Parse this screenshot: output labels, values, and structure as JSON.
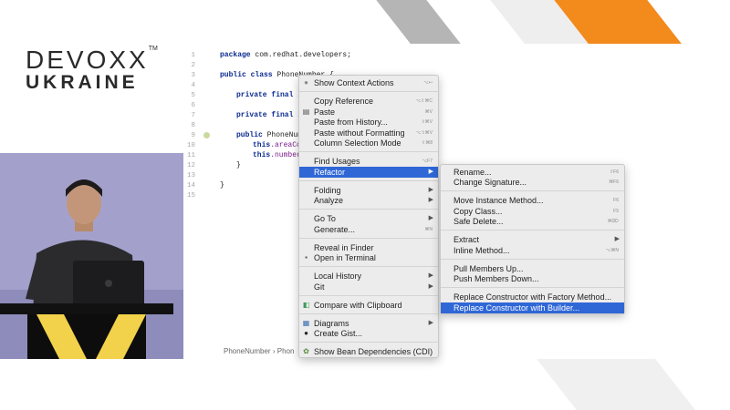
{
  "logo": {
    "line1": "DEVOXX",
    "tm": "TM",
    "line2": "UKRAINE"
  },
  "colors": {
    "accent_orange": "#f28a1c",
    "selection": "#2f67d6",
    "menu_bg": "#ececec"
  },
  "editor": {
    "line_numbers": [
      "1",
      "2",
      "3",
      "4",
      "5",
      "6",
      "7",
      "8",
      "9",
      "10",
      "11",
      "12",
      "13",
      "14",
      "15"
    ],
    "lines": {
      "l1": {
        "kw": "package",
        "rest": " com.redhat.developers;"
      },
      "l3": {
        "kw": "public class",
        "rest": " PhoneNumber {"
      },
      "l5": {
        "kw": "private final",
        "rest": " in"
      },
      "l7": {
        "kw": "private final",
        "rest": " in"
      },
      "l9": {
        "kw": "public",
        "rest": " PhoneNumb"
      },
      "l10": {
        "kw": "this",
        "field": ".areaCod"
      },
      "l11": {
        "kw": "this",
        "field": ".number"
      },
      "l12": "}",
      "l14": "}"
    },
    "breadcrumb": [
      "PhoneNumber",
      "›",
      "Phon"
    ]
  },
  "context_menu": {
    "items": {
      "show_context_actions": "Show Context Actions",
      "copy_reference": "Copy Reference",
      "paste": "Paste",
      "paste_from_history": "Paste from History...",
      "paste_without_formatting": "Paste without Formatting",
      "column_selection_mode": "Column Selection Mode",
      "find_usages": "Find Usages",
      "refactor": "Refactor",
      "folding": "Folding",
      "analyze": "Analyze",
      "go_to": "Go To",
      "generate": "Generate...",
      "reveal_in_finder": "Reveal in Finder",
      "open_in_terminal": "Open in Terminal",
      "local_history": "Local History",
      "git": "Git",
      "compare_with_clipboard": "Compare with Clipboard",
      "diagrams": "Diagrams",
      "create_gist": "Create Gist...",
      "show_bean_dependencies": "Show Bean Dependencies (CDI)"
    },
    "shortcuts": {
      "show_context_actions": "⌥↩",
      "copy_reference": "⌥⇧⌘C",
      "paste": "⌘V",
      "paste_from_history": "⇧⌘V",
      "paste_without_formatting": "⌥⇧⌘V",
      "column_selection_mode": "⇧⌘8",
      "find_usages": "⌥F7",
      "generate": "⌘N"
    }
  },
  "refactor_submenu": {
    "items": {
      "rename": "Rename...",
      "change_signature": "Change Signature...",
      "move_instance_method": "Move Instance Method...",
      "copy_class": "Copy Class...",
      "safe_delete": "Safe Delete...",
      "extract": "Extract",
      "inline_method": "Inline Method...",
      "pull_members_up": "Pull Members Up...",
      "push_members_down": "Push Members Down...",
      "replace_constructor_factory": "Replace Constructor with Factory Method...",
      "replace_constructor_builder": "Replace Constructor with Builder..."
    },
    "shortcuts": {
      "rename": "⇧F6",
      "change_signature": "⌘F6",
      "move_instance_method": "F6",
      "copy_class": "F5",
      "safe_delete": "⌘⌦",
      "inline_method": "⌥⌘N"
    }
  }
}
